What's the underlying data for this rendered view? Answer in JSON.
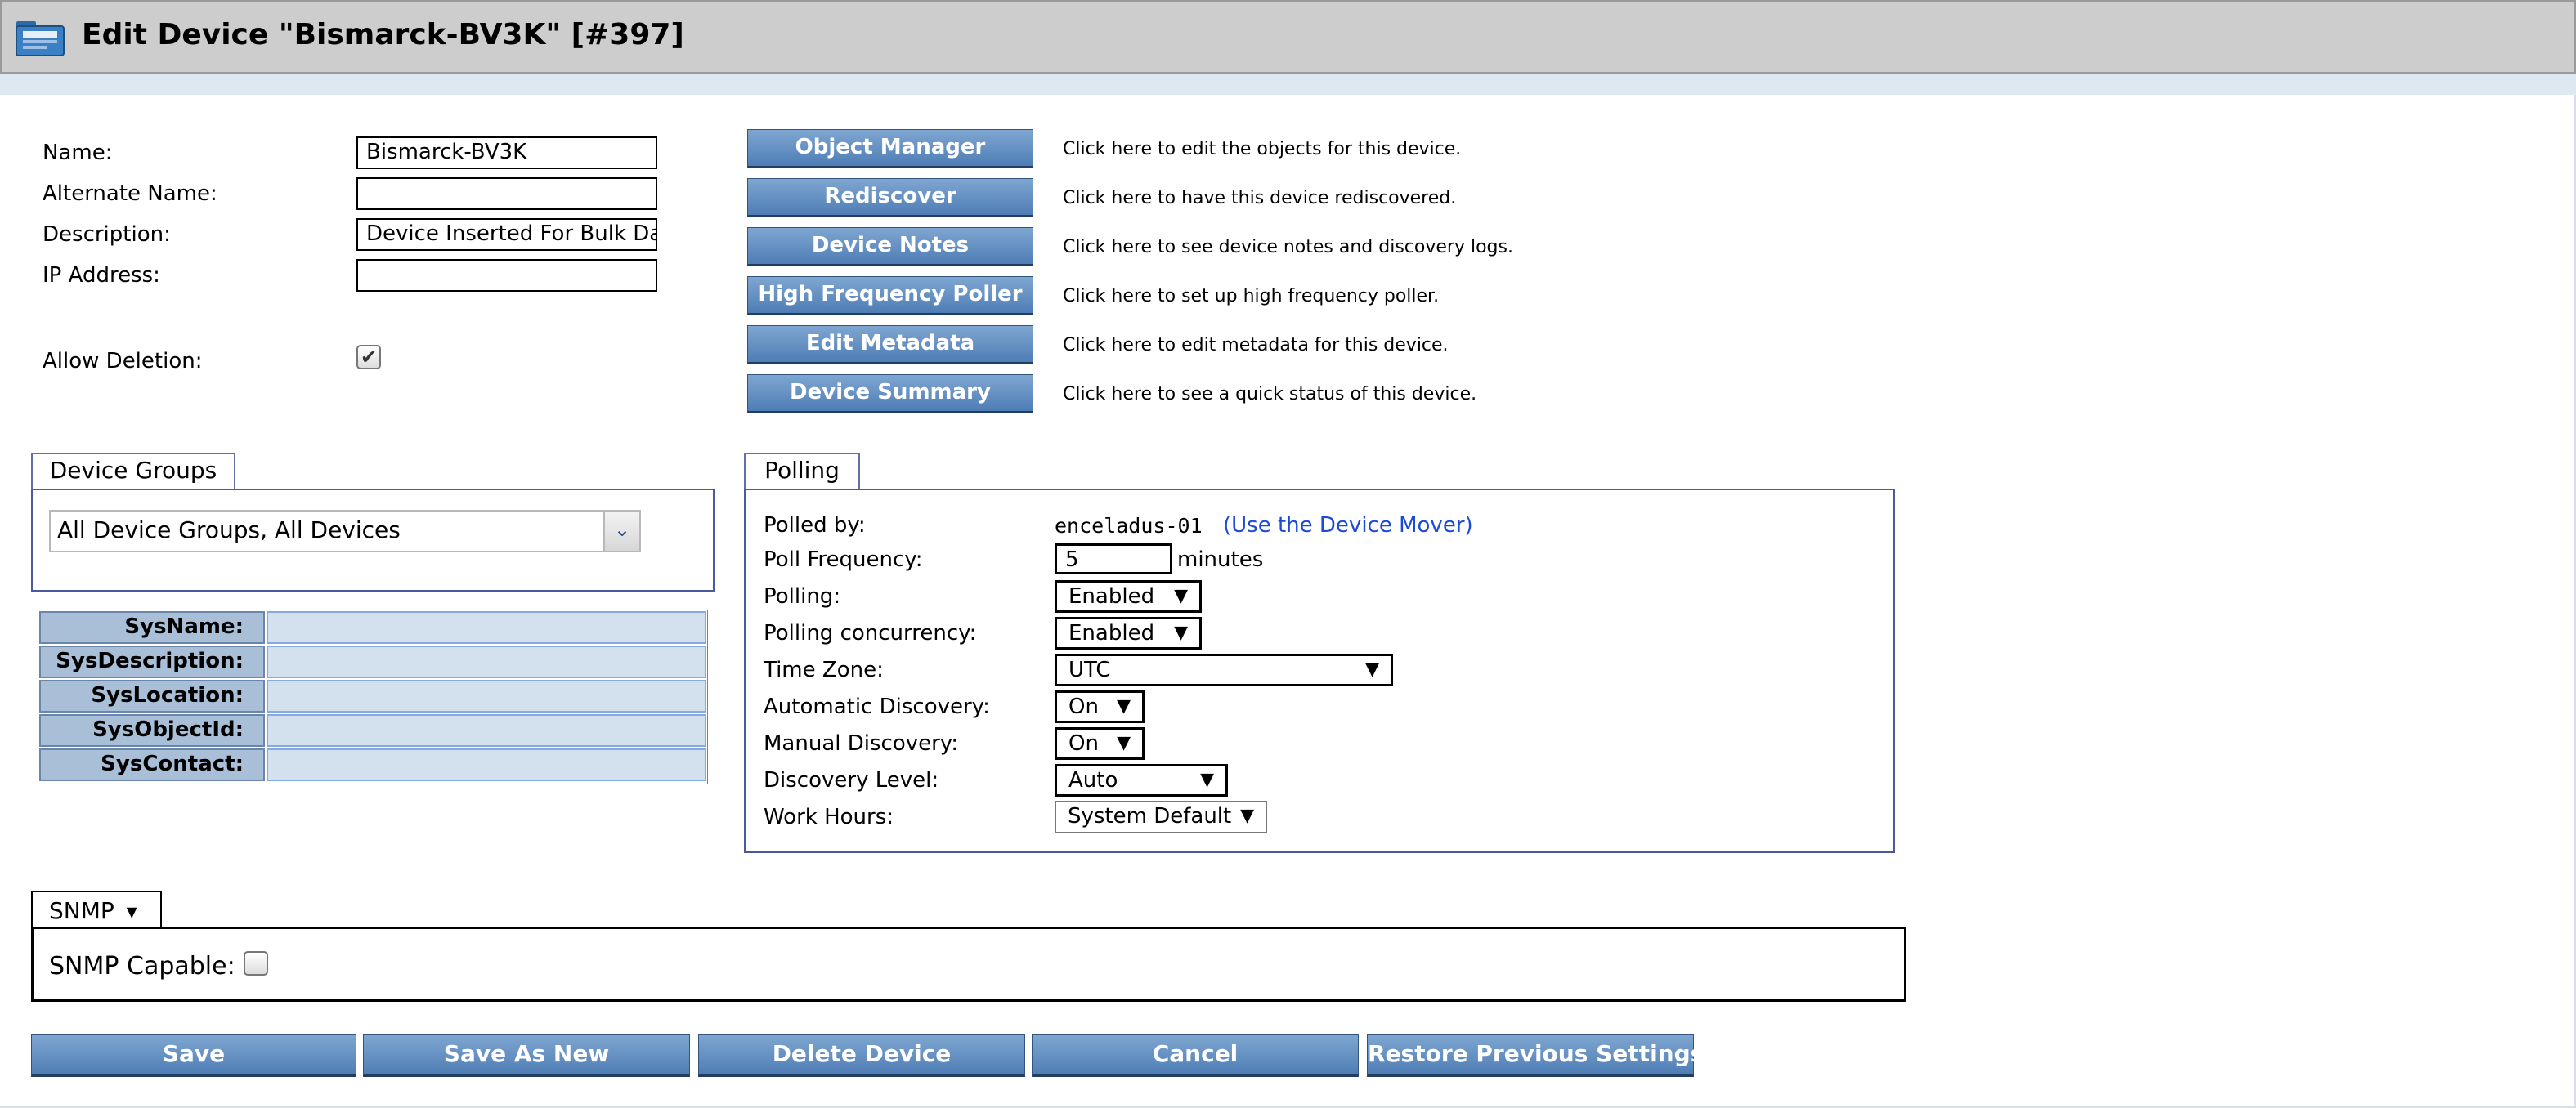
{
  "header": {
    "title": "Edit Device \"Bismarck-BV3K\" [#397]",
    "icon": "folder-icon"
  },
  "device_form": {
    "name_label": "Name:",
    "name_value": "Bismarck-BV3K",
    "alt_name_label": "Alternate Name:",
    "alt_name_value": "",
    "description_label": "Description:",
    "description_value": "Device Inserted For Bulk Dat",
    "ip_label": "IP Address:",
    "ip_value": "",
    "allow_deletion_label": "Allow Deletion:",
    "allow_deletion_checked": true
  },
  "actions": [
    {
      "label": "Object Manager",
      "description": "Click here to edit the objects for this device."
    },
    {
      "label": "Rediscover",
      "description": "Click here to have this device rediscovered."
    },
    {
      "label": "Device Notes",
      "description": "Click here to see device notes and discovery logs."
    },
    {
      "label": "High Frequency Poller",
      "description": "Click here to set up high frequency poller."
    },
    {
      "label": "Edit Metadata",
      "description": "Click here to edit metadata for this device."
    },
    {
      "label": "Device Summary",
      "description": "Click here to see a quick status of this device."
    }
  ],
  "device_groups": {
    "tab_label": "Device Groups",
    "selected": "All Device Groups, All Devices"
  },
  "sys_table": [
    {
      "label": "SysName:",
      "value": ""
    },
    {
      "label": "SysDescription:",
      "value": ""
    },
    {
      "label": "SysLocation:",
      "value": ""
    },
    {
      "label": "SysObjectId:",
      "value": ""
    },
    {
      "label": "SysContact:",
      "value": ""
    }
  ],
  "polling": {
    "tab_label": "Polling",
    "polled_by_label": "Polled by:",
    "polled_by_value": "enceladus-01",
    "device_mover_link": "(Use the Device Mover)",
    "poll_frequency_label": "Poll Frequency:",
    "poll_frequency_value": "5",
    "poll_frequency_unit": "minutes",
    "polling_label": "Polling:",
    "polling_value": "Enabled",
    "concurrency_label": "Polling concurrency:",
    "concurrency_value": "Enabled",
    "timezone_label": "Time Zone:",
    "timezone_value": "UTC",
    "auto_discovery_label": "Automatic Discovery:",
    "auto_discovery_value": "On",
    "manual_discovery_label": "Manual Discovery:",
    "manual_discovery_value": "On",
    "discovery_level_label": "Discovery Level:",
    "discovery_level_value": "Auto",
    "work_hours_label": "Work Hours:",
    "work_hours_value": "System Default"
  },
  "snmp": {
    "tab_label": "SNMP",
    "capable_label": "SNMP Capable:",
    "capable_checked": false
  },
  "footer_buttons": {
    "save": "Save",
    "save_as_new": "Save As New",
    "delete": "Delete Device",
    "cancel": "Cancel",
    "restore": "Restore Previous Settings"
  },
  "glyphs": {
    "check": "✔",
    "dropdown": "▼",
    "tab_caret": "▾"
  },
  "colors": {
    "button_top": "#7fa6d1",
    "button_bottom": "#4e7db5",
    "link": "#1a4bd6",
    "panel_border": "#4b5aa0"
  }
}
